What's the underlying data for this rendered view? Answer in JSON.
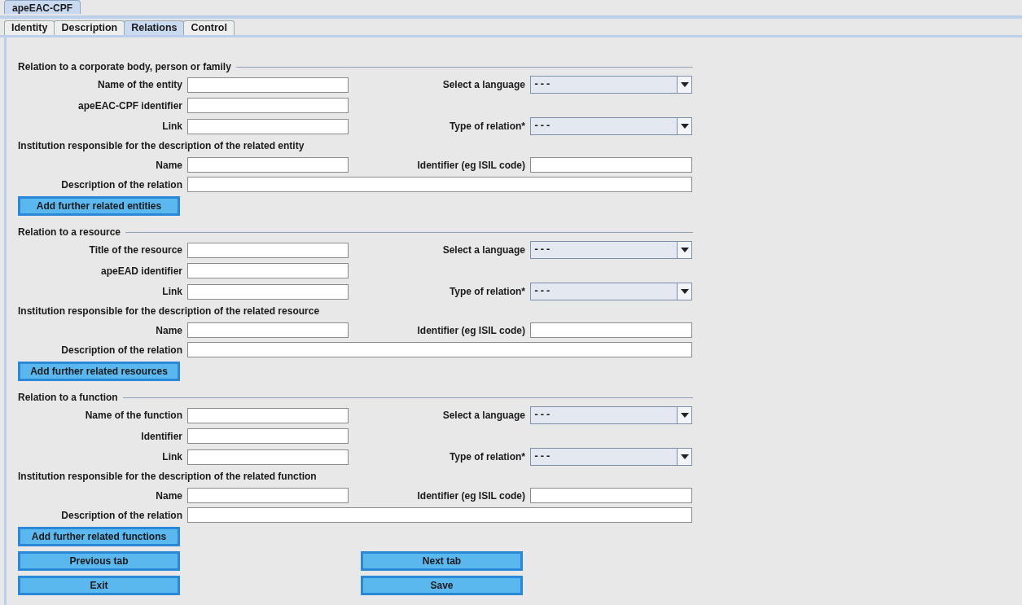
{
  "window": {
    "title": "apeEAC-CPF"
  },
  "tabs": [
    {
      "label": "Identity",
      "selected": false
    },
    {
      "label": "Description",
      "selected": false
    },
    {
      "label": "Relations",
      "selected": true
    },
    {
      "label": "Control",
      "selected": false
    }
  ],
  "sections": [
    {
      "title": "Relation to a corporate body, person or family",
      "rows": [
        {
          "kind": "field",
          "label": "Name of the entity",
          "right": {
            "kind": "select",
            "label": "Select a language",
            "value": "---"
          }
        },
        {
          "kind": "field",
          "label": "apeEAC-CPF identifier"
        },
        {
          "kind": "field",
          "label": "Link",
          "right": {
            "kind": "select",
            "label": "Type of relation*",
            "value": "---"
          }
        },
        {
          "kind": "heading",
          "text": "Institution responsible for the description of the related entity"
        },
        {
          "kind": "field",
          "label": "Name",
          "right": {
            "kind": "text",
            "label": "Identifier (eg ISIL code)"
          }
        },
        {
          "kind": "wide",
          "label": "Description of the relation"
        }
      ],
      "button": "Add further related entities"
    },
    {
      "title": "Relation to a resource",
      "rows": [
        {
          "kind": "field",
          "label": "Title of the resource",
          "right": {
            "kind": "select",
            "label": "Select a language",
            "value": "---"
          }
        },
        {
          "kind": "field",
          "label": "apeEAD identifier"
        },
        {
          "kind": "field",
          "label": "Link",
          "right": {
            "kind": "select",
            "label": "Type of relation*",
            "value": "---"
          }
        },
        {
          "kind": "heading",
          "text": "Institution responsible for the description of the related resource"
        },
        {
          "kind": "field",
          "label": "Name",
          "right": {
            "kind": "text",
            "label": "Identifier (eg ISIL code)"
          }
        },
        {
          "kind": "wide",
          "label": "Description of the relation"
        }
      ],
      "button": "Add further related resources"
    },
    {
      "title": "Relation to a function",
      "rows": [
        {
          "kind": "field",
          "label": "Name of the function",
          "right": {
            "kind": "select",
            "label": "Select a language",
            "value": "---"
          }
        },
        {
          "kind": "field",
          "label": "Identifier"
        },
        {
          "kind": "field",
          "label": "Link",
          "right": {
            "kind": "select",
            "label": "Type of relation*",
            "value": "---"
          }
        },
        {
          "kind": "heading",
          "text": "Institution responsible for the description of the related function"
        },
        {
          "kind": "field",
          "label": "Name",
          "right": {
            "kind": "text",
            "label": "Identifier (eg ISIL code)"
          }
        },
        {
          "kind": "wide",
          "label": "Description of the relation"
        }
      ],
      "button": "Add further related functions"
    }
  ],
  "nav_buttons": [
    [
      "Previous tab",
      "Next tab"
    ],
    [
      "Exit",
      "Save"
    ]
  ]
}
